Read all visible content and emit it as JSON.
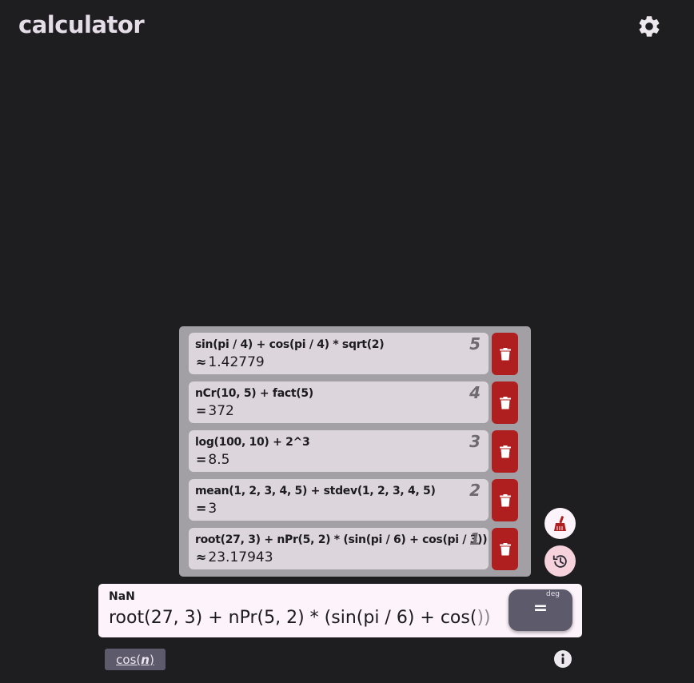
{
  "app": {
    "title": "calculator"
  },
  "history": {
    "items": [
      {
        "index": "5",
        "expression": "sin(pi / 4) + cos(pi / 4) * sqrt(2)",
        "symbol": "≈",
        "result": "1.42779"
      },
      {
        "index": "4",
        "expression": "nCr(10, 5) + fact(5)",
        "symbol": "=",
        "result": "372"
      },
      {
        "index": "3",
        "expression": "log(100, 10) + 2^3",
        "symbol": "=",
        "result": "8.5"
      },
      {
        "index": "2",
        "expression": "mean(1, 2, 3, 4, 5) + stdev(1, 2, 3, 4, 5)",
        "symbol": "=",
        "result": "3"
      },
      {
        "index": "1",
        "expression": "root(27, 3) + nPr(5, 2) * (sin(pi / 6) + cos(pi / 3))",
        "symbol": "≈",
        "result": "23.17943"
      }
    ]
  },
  "input": {
    "preview": "NaN",
    "expression": "root(27, 3) + nPr(5, 2) * (sin(pi / 6) + cos(",
    "auto_close": "))"
  },
  "equals_button": {
    "label": "=",
    "mode": "deg"
  },
  "suggestion": {
    "func": "cos(",
    "arg": "n",
    "close": ")"
  },
  "colors": {
    "background": "#1e1d20",
    "panel": "#a29fa5",
    "card": "#dcd6dc",
    "delete": "#b01f1f",
    "accent": "#5d5a6c",
    "input_bg": "#fdf4fb"
  },
  "icons": {
    "settings": "gear-icon",
    "delete": "trash-icon",
    "clear": "broom-icon",
    "history": "history-icon",
    "info": "info-icon"
  }
}
